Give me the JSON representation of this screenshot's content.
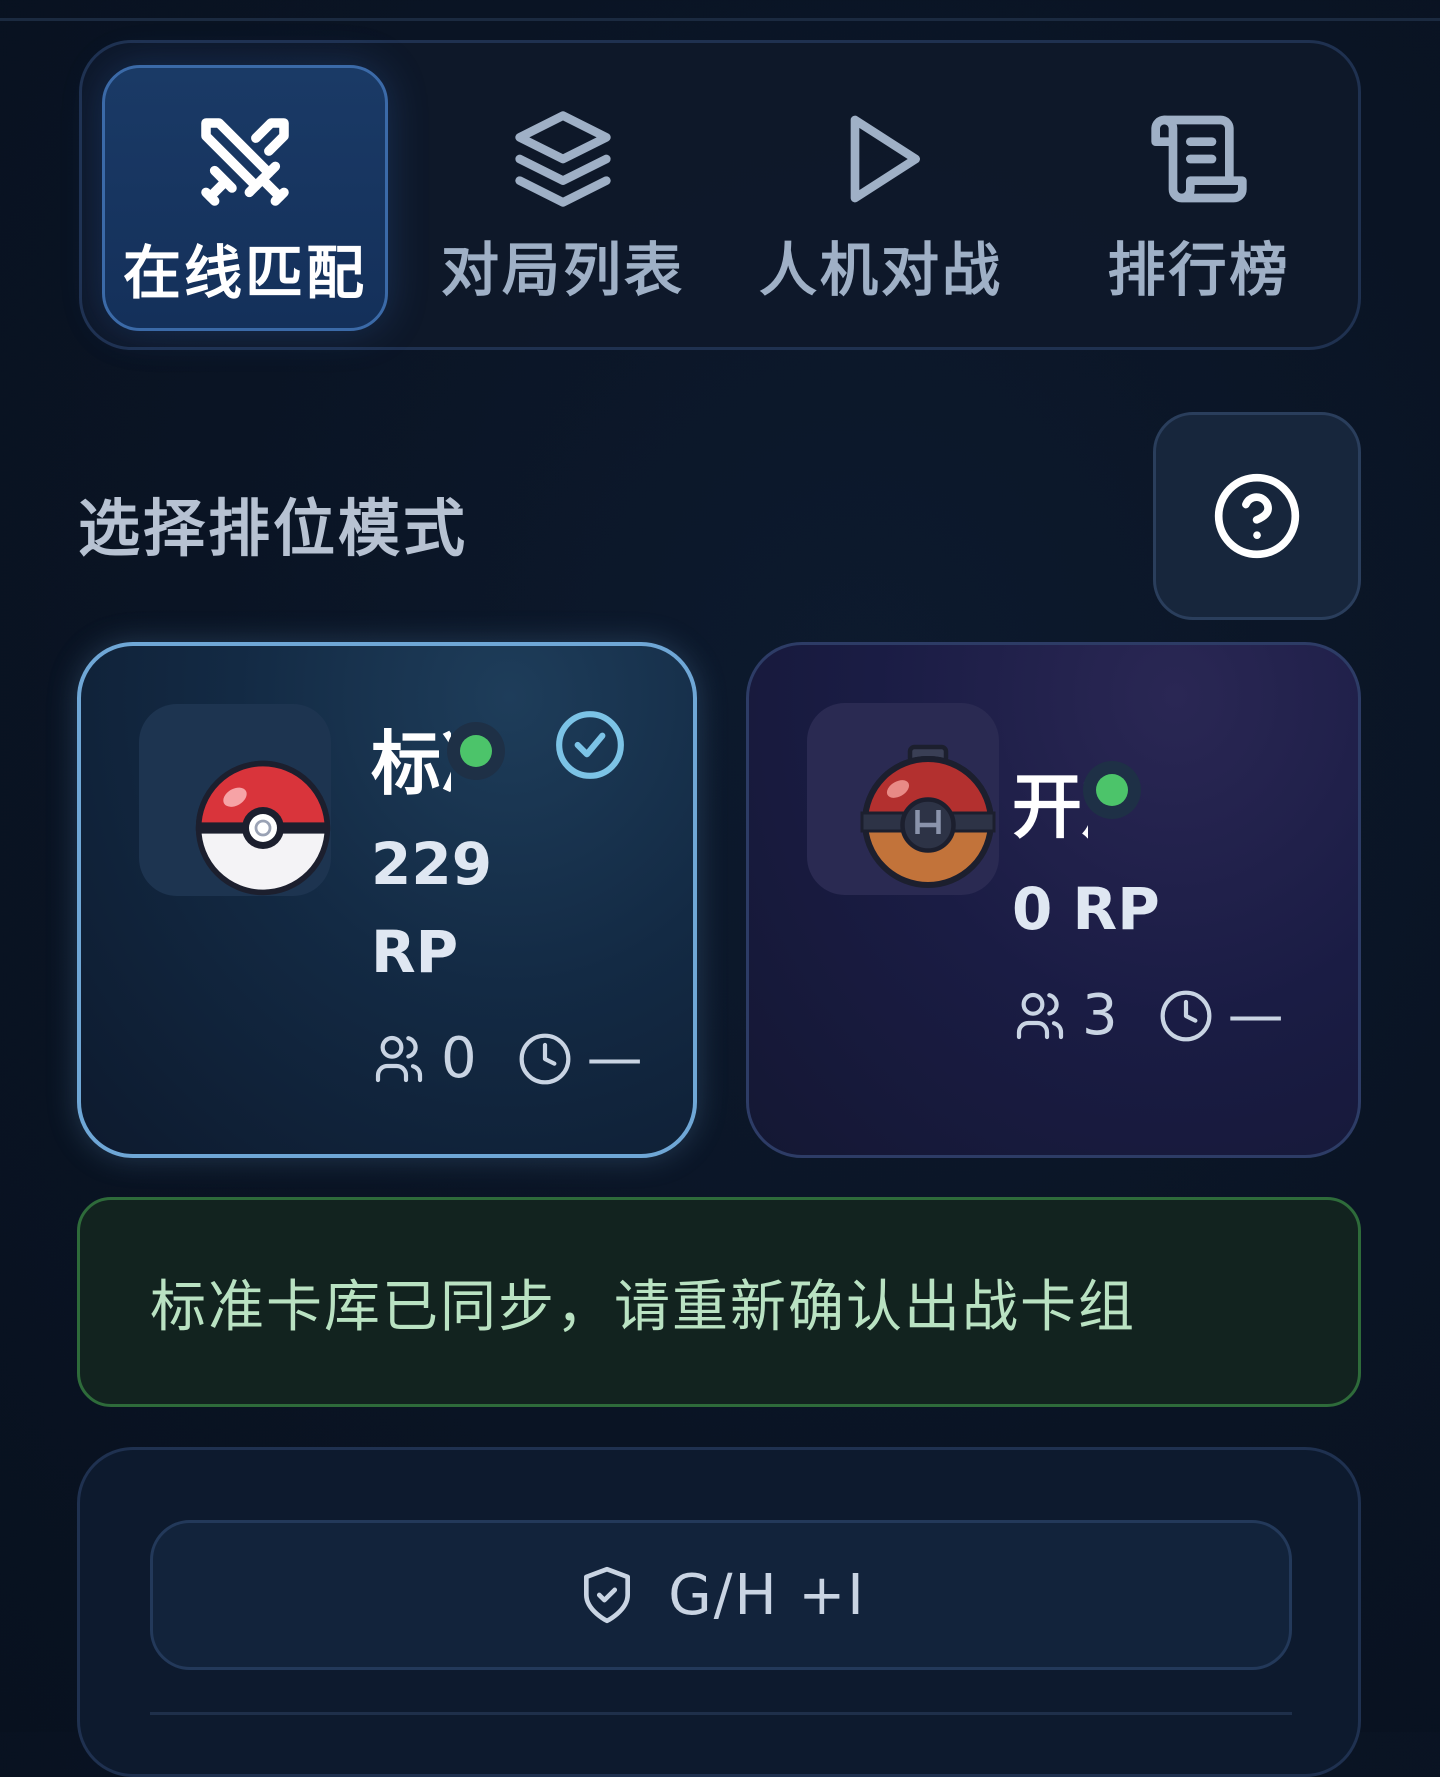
{
  "nav": {
    "items": [
      {
        "label": "在线匹配",
        "icon": "crossed-swords-icon",
        "active": true
      },
      {
        "label": "对局列表",
        "icon": "layers-icon",
        "active": false
      },
      {
        "label": "人机对战",
        "icon": "play-icon",
        "active": false
      },
      {
        "label": "排行榜",
        "icon": "scroll-icon",
        "active": false
      }
    ]
  },
  "section": {
    "title": "选择排位模式",
    "help_icon": "question-circle-icon"
  },
  "modes": [
    {
      "name": "标准",
      "rp_value": "229",
      "rp_unit": "RP",
      "players": "0",
      "wait": "—",
      "selected": true,
      "online": true,
      "icon": "pokeball-icon"
    },
    {
      "name": "开放",
      "rp": "0 RP",
      "players": "3",
      "wait": "—",
      "selected": false,
      "online": true,
      "icon": "heavy-ball-icon"
    }
  ],
  "notice": {
    "text": "标准卡库已同步，请重新确认出战卡组"
  },
  "panel": {
    "button_label": "G/H +I",
    "button_icon": "shield-check-icon"
  },
  "colors": {
    "accent": "#6fa7d6",
    "online": "#4cc46a",
    "notice_border": "#2e6b3a"
  }
}
